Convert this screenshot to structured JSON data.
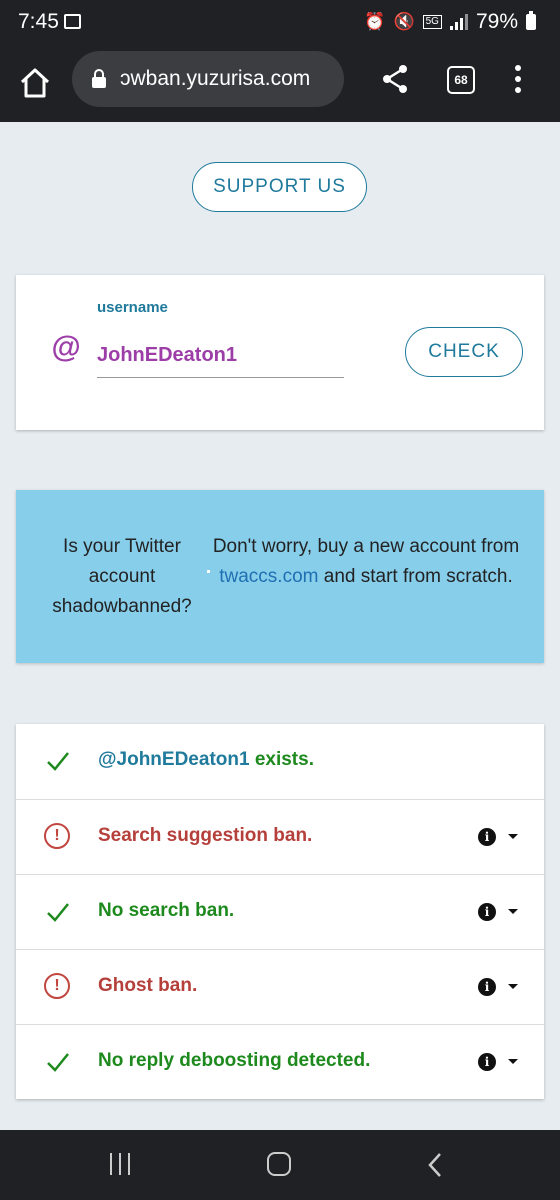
{
  "status_bar": {
    "time": "7:45",
    "network": "5G",
    "battery": "79%"
  },
  "browser": {
    "url": "ɔwban.yuzurisa.com",
    "tab_count": "68"
  },
  "support_button": "SUPPORT US",
  "search": {
    "label": "username",
    "at_symbol": "@",
    "value": "JohnEDeaton1",
    "check_button": "CHECK"
  },
  "ad": {
    "left_text": "Is your Twitter account shadowbanned?",
    "right_before": "Don't worry, buy a new account from ",
    "right_link": "twaccs.com",
    "right_after": " and start from scratch."
  },
  "results": [
    {
      "status": "ok",
      "user": "@JohnEDeaton1",
      "text": " exists.",
      "info": false
    },
    {
      "status": "bad",
      "text": "Search suggestion ban.",
      "info": true
    },
    {
      "status": "ok",
      "text": "No search ban.",
      "info": true
    },
    {
      "status": "bad",
      "text": "Ghost ban.",
      "info": true
    },
    {
      "status": "ok",
      "text": "No reply deboosting detected.",
      "info": true
    }
  ],
  "colors": {
    "accent": "#1f7a9c",
    "purple": "#9c3da8",
    "ok": "#1e8a1e",
    "bad": "#b5403b",
    "ad_bg": "#87ceeb",
    "page_bg": "#e6ecf0"
  },
  "icons": [
    "alarm-icon",
    "mute-icon",
    "signal-icon",
    "battery-icon",
    "home-icon",
    "lock-icon",
    "share-icon",
    "more-icon",
    "check-icon",
    "warning-icon",
    "info-icon",
    "chevron-down-icon",
    "recent-apps-icon",
    "home-button-icon",
    "back-icon"
  ]
}
